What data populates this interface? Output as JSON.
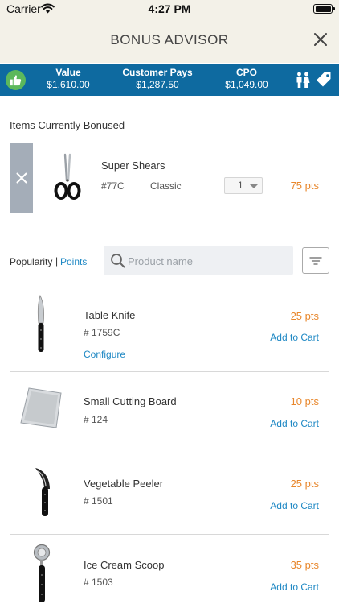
{
  "status_bar": {
    "carrier": "Carrier",
    "time": "4:27 PM"
  },
  "header": {
    "title": "BONUS ADVISOR"
  },
  "summary": {
    "columns": [
      {
        "label": "Value",
        "value": "$1,610.00"
      },
      {
        "label": "Customer Pays",
        "value": "$1,287.50"
      },
      {
        "label": "CPO",
        "value": "$1,049.00"
      }
    ],
    "colors": {
      "bar": "#0e6aa0",
      "thumb": "#5cb85c"
    },
    "icons": [
      "thumbs-up-icon",
      "people-icon",
      "tag-icon"
    ]
  },
  "bonused": {
    "section_title": "Items Currently Bonused",
    "item": {
      "name": "Super Shears",
      "sku": "#77C",
      "variant": "Classic",
      "quantity": "1",
      "points": "75 pts"
    }
  },
  "filter": {
    "sort_label": "Popularity",
    "sort_separator": "|",
    "sort_points": "Points",
    "search_placeholder": "Product name"
  },
  "products": [
    {
      "name": "Table Knife",
      "sku": "# 1759C",
      "points": "25 pts",
      "cart_label": "Add to Cart",
      "configure": "Configure",
      "icon": "table-knife-image"
    },
    {
      "name": "Small Cutting Board",
      "sku": "# 124",
      "points": "10 pts",
      "cart_label": "Add to Cart",
      "icon": "cutting-board-image"
    },
    {
      "name": "Vegetable Peeler",
      "sku": "# 1501",
      "points": "25 pts",
      "cart_label": "Add to Cart",
      "icon": "peeler-image"
    },
    {
      "name": "Ice Cream Scoop",
      "sku": "# 1503",
      "points": "35 pts",
      "cart_label": "Add to Cart",
      "icon": "ice-cream-scoop-image"
    }
  ],
  "accent_colors": {
    "points": "#e8872c",
    "link": "#1e88c4"
  }
}
